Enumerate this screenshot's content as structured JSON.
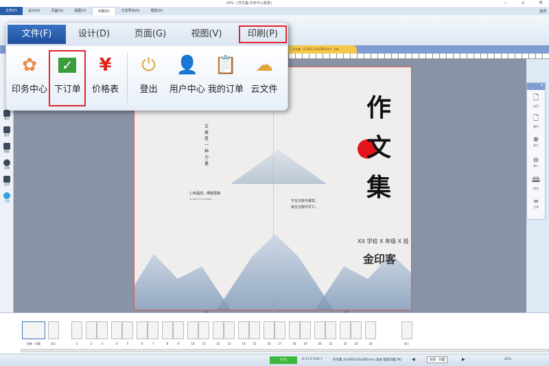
{
  "window": {
    "title": "DPS - [作文集-印务中心登录]"
  },
  "menubar": {
    "tabs": [
      "文件(F)",
      "设计(D)",
      "页面(G)",
      "视图(V)",
      "印刷(P)",
      "分享导出(S)",
      "帮助(H)"
    ],
    "right": "选项"
  },
  "document_tab": "作文集（大16开,210x285mm）.dps",
  "popup": {
    "tabs": [
      "文件(F)",
      "设计(D)",
      "页面(G)",
      "视图(V)",
      "印刷(P)"
    ],
    "items": [
      {
        "label": "印务中心",
        "icon": "puzzle-icon"
      },
      {
        "label": "下订单",
        "icon": "checkbox-icon"
      },
      {
        "label": "价格表",
        "icon": "yen-icon"
      },
      {
        "label": "登出",
        "icon": "power-icon"
      },
      {
        "label": "用户中心",
        "icon": "user-icon"
      },
      {
        "label": "我的订单",
        "icon": "clipboard-icon"
      },
      {
        "label": "云文件",
        "icon": "cloud-icon"
      }
    ]
  },
  "left_sidebar": [
    "素材",
    "图文",
    "模板",
    "背景",
    "形状",
    "工具"
  ],
  "right_toolbar": [
    "加页",
    "删页",
    "放大",
    "缩小",
    "阅览",
    "分享"
  ],
  "cover": {
    "title_chars": [
      "作",
      "文",
      "集"
    ],
    "vertical_text": "文章是一种力量",
    "left_quote": "心有猛虎，细嗅蔷薇",
    "left_sub": "IN SIGHT OF SUMMER",
    "right_quote_1": "不在沉默中爆发，",
    "right_quote_2": "就在沉默中灭亡。",
    "class": "XX 学校 X 年级 X 班",
    "brand": "金印客",
    "left_label": "封底",
    "right_label": "封面"
  },
  "thumbnails": [
    "封底 - 封面",
    "封二",
    "1",
    "2",
    "3",
    "4",
    "5",
    "6",
    "7",
    "8",
    "9",
    "10",
    "11",
    "12",
    "13",
    "14",
    "15",
    "16",
    "17",
    "18",
    "19",
    "20",
    "21",
    "22",
    "23",
    "24",
    "封三"
  ],
  "status": {
    "page": "1/15",
    "coords": "X:17.0 Y:20.7",
    "doc_info": "作文集 大16开(210x285mm) 竖式 锁定页面 [N]",
    "current_page": "封底 - 封面",
    "zoom": "42%"
  }
}
